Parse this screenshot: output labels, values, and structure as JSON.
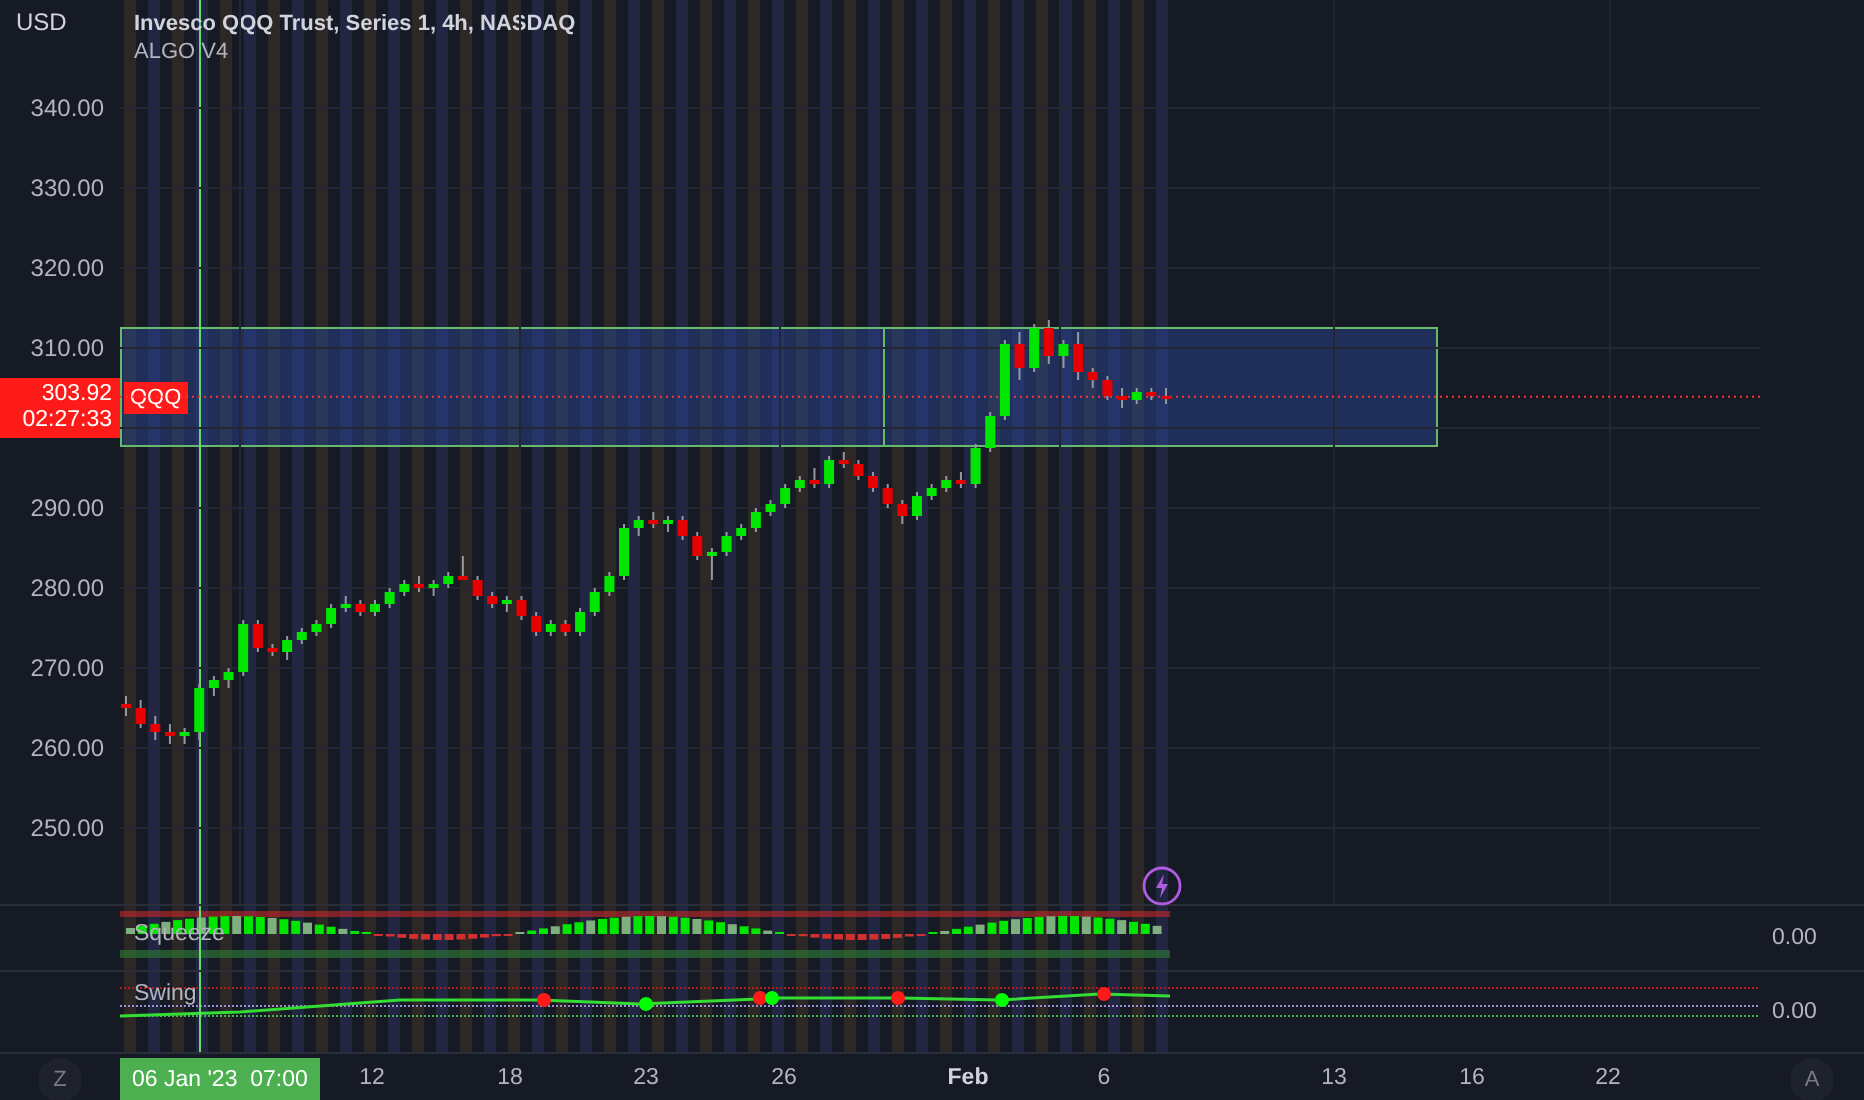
{
  "header": {
    "title": "Invesco QQQ Trust, Series 1, 4h, NASDAQ",
    "indicator": "ALGO V4"
  },
  "price_axis": {
    "currency": "USD",
    "last_price": "303.92",
    "countdown": "02:27:33"
  },
  "symbol_tag": "QQQ",
  "price_chart": {
    "chart_data": {
      "type": "candlestick",
      "grid": true,
      "ylim": [
        240.5,
        353.5
      ],
      "ref_lines": [
        {
          "axis": "y",
          "value": 303.92
        }
      ],
      "yticks": [
        {
          "value": 340,
          "label": "340.00"
        },
        {
          "value": 330,
          "label": "330.00"
        },
        {
          "value": 320,
          "label": "320.00"
        },
        {
          "value": 310,
          "label": "310.00"
        },
        {
          "value": 290,
          "label": "290.00"
        },
        {
          "value": 280,
          "label": "280.00"
        },
        {
          "value": 270,
          "label": "270.00"
        },
        {
          "value": 260,
          "label": "260.00"
        },
        {
          "value": 250,
          "label": "250.00"
        }
      ],
      "ohlc": [
        [
          265.5,
          266.5,
          264,
          265
        ],
        [
          265,
          266,
          262.5,
          263
        ],
        [
          263,
          264,
          261,
          262
        ],
        [
          262,
          263,
          260.5,
          261.5
        ],
        [
          261.5,
          262.5,
          260.5,
          262
        ],
        [
          262,
          268,
          261,
          267.5
        ],
        [
          267.5,
          269,
          266.5,
          268.5
        ],
        [
          268.5,
          270,
          267.5,
          269.5
        ],
        [
          269.5,
          276,
          269,
          275.5
        ],
        [
          275.5,
          276,
          272,
          272.5
        ],
        [
          272.5,
          273,
          271.5,
          272
        ],
        [
          272,
          274,
          271,
          273.5
        ],
        [
          273.5,
          275,
          273,
          274.5
        ],
        [
          274.5,
          276,
          274,
          275.5
        ],
        [
          275.5,
          278,
          275,
          277.5
        ],
        [
          277.5,
          279,
          277,
          278
        ],
        [
          278,
          278.5,
          276.5,
          277
        ],
        [
          277,
          278.5,
          276.5,
          278
        ],
        [
          278,
          280,
          277.5,
          279.5
        ],
        [
          279.5,
          281,
          279,
          280.5
        ],
        [
          280.5,
          281.5,
          279.5,
          280
        ],
        [
          280,
          281,
          279,
          280.5
        ],
        [
          280.5,
          282,
          280,
          281.5
        ],
        [
          281.5,
          284,
          281,
          281
        ],
        [
          281,
          281.5,
          278.5,
          279
        ],
        [
          279,
          279.5,
          277.5,
          278
        ],
        [
          278,
          279,
          277,
          278.5
        ],
        [
          278.5,
          279,
          276,
          276.5
        ],
        [
          276.5,
          277,
          274,
          274.5
        ],
        [
          274.5,
          276,
          274,
          275.5
        ],
        [
          275.5,
          276,
          274,
          274.5
        ],
        [
          274.5,
          277.5,
          274,
          277
        ],
        [
          277,
          280,
          276.5,
          279.5
        ],
        [
          279.5,
          282,
          279,
          281.5
        ],
        [
          281.5,
          288,
          281,
          287.5
        ],
        [
          287.5,
          289,
          286.5,
          288.5
        ],
        [
          288.5,
          289.5,
          287.5,
          288
        ],
        [
          288,
          289,
          287,
          288.5
        ],
        [
          288.5,
          289,
          286,
          286.5
        ],
        [
          286.5,
          287,
          283.5,
          284
        ],
        [
          284,
          285,
          281,
          284.5
        ],
        [
          284.5,
          287,
          284,
          286.5
        ],
        [
          286.5,
          288,
          286,
          287.5
        ],
        [
          287.5,
          290,
          287,
          289.5
        ],
        [
          289.5,
          291,
          289,
          290.5
        ],
        [
          290.5,
          293,
          290,
          292.5
        ],
        [
          292.5,
          294,
          292,
          293.5
        ],
        [
          293.5,
          295,
          292.5,
          293
        ],
        [
          293,
          296.5,
          292.5,
          296
        ],
        [
          296,
          297,
          295,
          295.5
        ],
        [
          295.5,
          296,
          293.5,
          294
        ],
        [
          294,
          294.5,
          292,
          292.5
        ],
        [
          292.5,
          293,
          290,
          290.5
        ],
        [
          290.5,
          291,
          288,
          289
        ],
        [
          289,
          292,
          288.5,
          291.5
        ],
        [
          291.5,
          293,
          291,
          292.5
        ],
        [
          292.5,
          294,
          292,
          293.5
        ],
        [
          293.5,
          294.5,
          292.5,
          293
        ],
        [
          293,
          298,
          292.5,
          297.5
        ],
        [
          297.5,
          302,
          297,
          301.5
        ],
        [
          301.5,
          311,
          301,
          310.5
        ],
        [
          310.5,
          312,
          306,
          307.5
        ],
        [
          307.5,
          313,
          307,
          312.5
        ],
        [
          312.5,
          313.5,
          308,
          309
        ],
        [
          309,
          311,
          307.5,
          310.5
        ],
        [
          310.5,
          312,
          306,
          307
        ],
        [
          307,
          307.5,
          305,
          306
        ],
        [
          306,
          306.5,
          303.5,
          304
        ],
        [
          304,
          305,
          302.5,
          303.5
        ],
        [
          303.5,
          305,
          303,
          304.5
        ],
        [
          304.5,
          305,
          303.5,
          304
        ],
        [
          304,
          305,
          303,
          303.92
        ]
      ]
    }
  },
  "panes": [
    {
      "kind": "histogram",
      "label": "Squeeze",
      "value": "0.00"
    },
    {
      "kind": "line",
      "label": "Swing",
      "value": "0.00"
    }
  ],
  "time_axis": {
    "left_button": "Z",
    "crosshair_label": "06 Jan '23  07:00",
    "right_button": "A",
    "ticks": [
      {
        "label": "12",
        "major": false
      },
      {
        "label": "18",
        "major": false
      },
      {
        "label": "23",
        "major": false
      },
      {
        "label": "26",
        "major": false
      },
      {
        "label": "Feb",
        "major": true
      },
      {
        "label": "6",
        "major": false
      },
      {
        "label": "13",
        "major": false
      },
      {
        "label": "16",
        "major": false
      },
      {
        "label": "22",
        "major": false
      }
    ]
  }
}
